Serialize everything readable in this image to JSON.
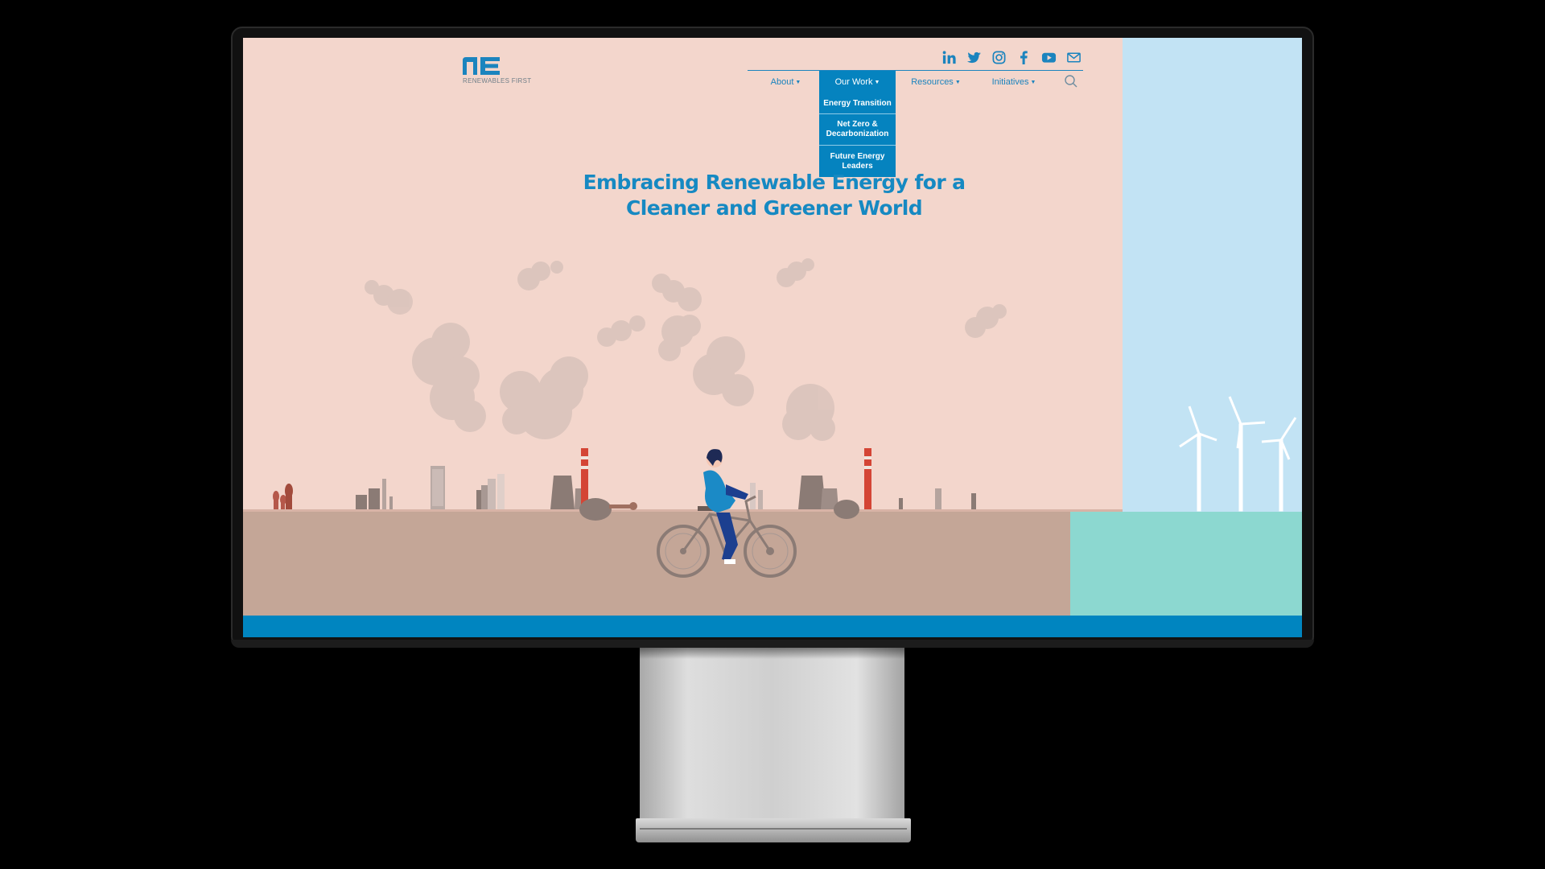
{
  "site": {
    "logo": {
      "mark_label": "RE",
      "text": "RENEWABLES FIRST"
    },
    "social": [
      "linkedin-icon",
      "twitter-icon",
      "instagram-icon",
      "facebook-icon",
      "youtube-icon",
      "mail-icon"
    ],
    "nav": {
      "items": [
        {
          "label": "About"
        },
        {
          "label": "Our Work"
        },
        {
          "label": "Resources"
        },
        {
          "label": "Initiatives"
        }
      ],
      "active": "Our Work",
      "dropdown": [
        {
          "label": "Energy Transition"
        },
        {
          "label": "Net Zero & Decarbonization"
        },
        {
          "label": "Future Energy Leaders"
        }
      ]
    },
    "hero": {
      "headline_line1": "Embracing Renewable Energy for a",
      "headline_line2": "Cleaner and Greener World"
    }
  },
  "colors": {
    "brand_blue": "#0583bf",
    "background_pink": "#f3d6cc",
    "sky_blue": "#c2e3f4",
    "ground": "#c4a697",
    "sea": "#8cd8d0"
  }
}
